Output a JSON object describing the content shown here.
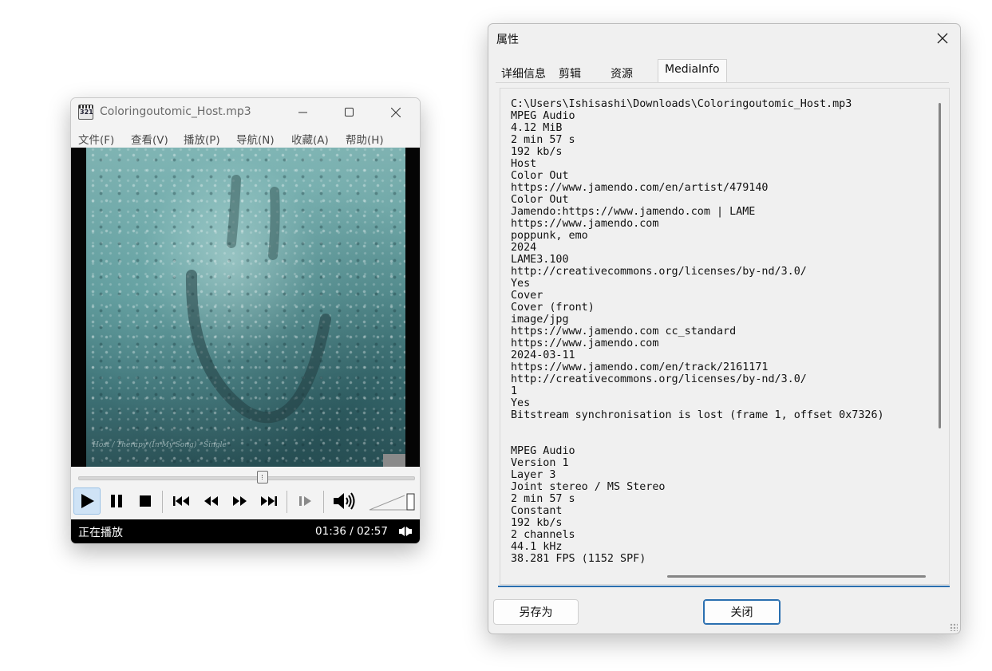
{
  "player": {
    "title": "Coloringoutomic_Host.mp3",
    "app_icon_text": "321",
    "menu": [
      "文件(F)",
      "查看(V)",
      "播放(P)",
      "导航(N)",
      "收藏(A)",
      "帮助(H)"
    ],
    "cover_caption": "Host / Therapy (In My Song) - Single",
    "seek_progress": 0.55,
    "volume_level": 1.0,
    "status": "正在播放",
    "time": "01:36 / 02:57",
    "icons": [
      "play-icon",
      "pause-icon",
      "stop-icon",
      "skip-previous-icon",
      "rewind-icon",
      "fast-forward-icon",
      "skip-next-icon",
      "frame-step-icon",
      "volume-icon"
    ]
  },
  "dialog": {
    "title": "属性",
    "tabs": [
      "详细信息",
      "剪辑",
      "资源",
      "MediaInfo"
    ],
    "selected_tab": "MediaInfo",
    "save_as_label": "另存为",
    "close_label": "关闭",
    "info_lines": [
      "C:\\Users\\Ishisashi\\Downloads\\Coloringoutomic_Host.mp3",
      "MPEG Audio",
      "4.12 MiB",
      "2 min 57 s",
      "192 kb/s",
      "Host",
      "Color Out",
      "https://www.jamendo.com/en/artist/479140",
      "Color Out",
      "Jamendo:https://www.jamendo.com | LAME",
      "https://www.jamendo.com",
      "poppunk, emo",
      "2024",
      "LAME3.100",
      "http://creativecommons.org/licenses/by-nd/3.0/",
      "Yes",
      "Cover",
      "Cover (front)",
      "image/jpg",
      "https://www.jamendo.com cc_standard",
      "https://www.jamendo.com",
      "2024-03-11",
      "https://www.jamendo.com/en/track/2161171",
      "http://creativecommons.org/licenses/by-nd/3.0/",
      "1",
      "Yes",
      "Bitstream synchronisation is lost (frame 1, offset 0x7326)",
      "",
      "",
      "MPEG Audio",
      "Version 1",
      "Layer 3",
      "Joint stereo / MS Stereo",
      "2 min 57 s",
      "Constant",
      "192 kb/s",
      "2 channels",
      "44.1 kHz",
      "38.281 FPS (1152 SPF)"
    ]
  }
}
